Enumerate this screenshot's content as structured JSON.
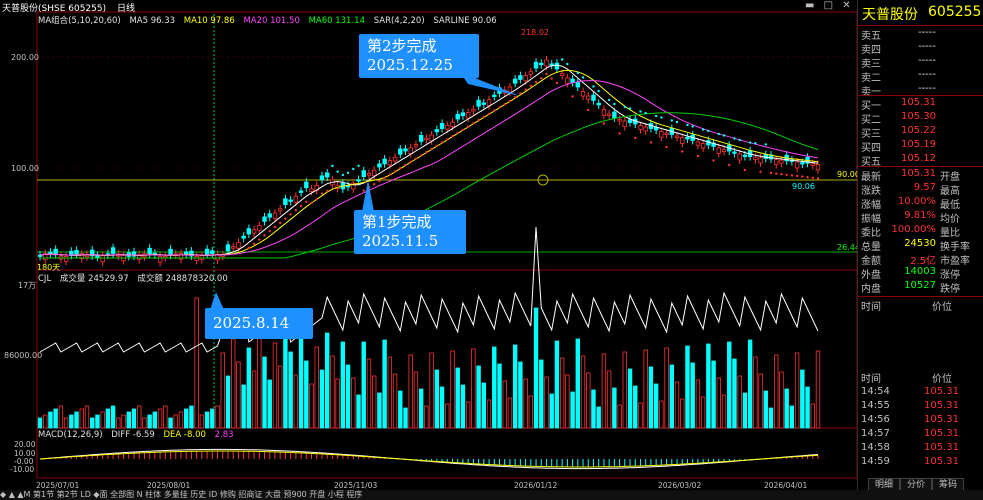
{
  "window": {
    "title": "天普股份(SHSE 605255)",
    "period": "日线"
  },
  "indicators": {
    "ma_group": "MA组合(5,10,20,60)",
    "ma5": "MA5 96.33",
    "ma10": "MA10 97.86",
    "ma20": "MA20 101.50",
    "ma60": "MA60 131.14",
    "sar": "SAR(4,2,20)",
    "sarline": "SARLINE 90.06"
  },
  "price_axis": {
    "p200": "200.00",
    "p100": "100.00"
  },
  "annotations": {
    "high": "218.02",
    "low_mark": "90.06",
    "right_90": "90.00",
    "right_26": "26.44",
    "x180": "180天"
  },
  "volume_panel": {
    "header_label": "CJL",
    "vol": "成交量 24529.97",
    "amount": "成交额 248878320.00",
    "axis_top": "17万",
    "axis_mid": "86000.00"
  },
  "macd_panel": {
    "label": "MACD(12,26,9)",
    "diff": "DIFF -6.59",
    "dea": "DEA -8.00",
    "macd": "2.83",
    "axis": [
      "20.00",
      "10.00",
      "-0.00",
      "-10.00"
    ]
  },
  "x_axis": [
    "2025/07/01",
    "2025/08/01",
    "2025/11/03",
    "2026/01/12",
    "2026/03/02",
    "2026/04/01"
  ],
  "callouts": {
    "step2_line1": "第2步完成",
    "step2_line2": "2025.12.25",
    "step1_line1": "第1步完成",
    "step1_line2": "2025.11.5",
    "date": "2025.8.14"
  },
  "quote": {
    "name": "天普股份",
    "code": "605255",
    "asks": [
      {
        "label": "卖五",
        "price": "-----"
      },
      {
        "label": "卖四",
        "price": "-----"
      },
      {
        "label": "卖三",
        "price": "-----"
      },
      {
        "label": "卖二",
        "price": "-----"
      },
      {
        "label": "卖一",
        "price": "-----"
      }
    ],
    "bids": [
      {
        "label": "买一",
        "price": "105.31"
      },
      {
        "label": "买二",
        "price": "105.30"
      },
      {
        "label": "买三",
        "price": "105.22"
      },
      {
        "label": "买四",
        "price": "105.19"
      },
      {
        "label": "买五",
        "price": "105.12"
      }
    ],
    "stats": [
      {
        "l1": "最新",
        "v1": "105.31",
        "l2": "开盘"
      },
      {
        "l1": "涨跌",
        "v1": "9.57",
        "l2": "最高"
      },
      {
        "l1": "涨幅",
        "v1": "10.00%",
        "l2": "最低"
      },
      {
        "l1": "振幅",
        "v1": "9.81%",
        "l2": "均价"
      },
      {
        "l1": "委比",
        "v1": "100.00%",
        "l2": "量比"
      },
      {
        "l1": "总量",
        "v1": "24530",
        "l2": "换手率"
      },
      {
        "l1": "金额",
        "v1": "2.5亿",
        "l2": "市盈率"
      },
      {
        "l1": "外盘",
        "v1": "14003",
        "l2": "涨停"
      },
      {
        "l1": "内盘",
        "v1": "10527",
        "l2": "跌停"
      }
    ],
    "ticks_header": {
      "time": "时间",
      "price": "价位"
    },
    "ticks_header2": {
      "time": "时间",
      "price": "价位"
    },
    "ticks": [
      {
        "time": "14:54",
        "price": "105.31"
      },
      {
        "time": "14:55",
        "price": "105.31"
      },
      {
        "time": "14:56",
        "price": "105.31"
      },
      {
        "time": "14:57",
        "price": "105.31"
      },
      {
        "time": "14:58",
        "price": "105.31"
      },
      {
        "time": "14:59",
        "price": "105.31"
      }
    ],
    "tabs": [
      "明细",
      "分价",
      "筹码"
    ]
  },
  "bottom_toolbar": "◆ ▲ ▲M 第1节 第2节 LD ◆面 全部图 N 柱体 多量挂 历史 ID 修购 招商证 大盘 预900 开盘 小程 程序"
}
